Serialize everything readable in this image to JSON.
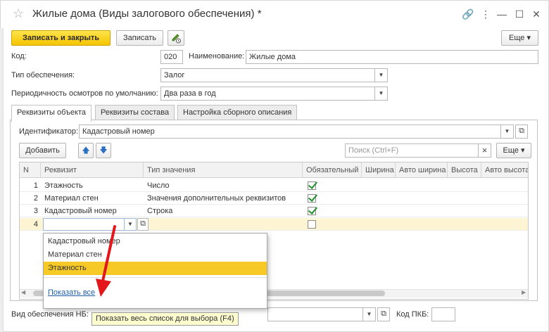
{
  "window": {
    "title": "Жилые дома (Виды залогового обеспечения) *",
    "star_glyph": "☆",
    "link_glyph": "🔗",
    "more_glyph": "⋮",
    "minimize_glyph": "—",
    "maximize_glyph": "☐",
    "close_glyph": "✕"
  },
  "toolbar": {
    "save_close_label": "Записать и закрыть",
    "save_label": "Записать",
    "edit_icon": "pencil-icon",
    "more_label": "Еще ▾"
  },
  "form": {
    "code_label": "Код:",
    "code_value": "020",
    "name_label": "Наименование:",
    "name_value": "Жилые дома",
    "security_type_label": "Тип обеспечения:",
    "security_type_value": "Залог",
    "inspection_label": "Периодичность осмотров по умолчанию:",
    "inspection_value": "Два раза в год",
    "bottom_label": "Вид обеспечения НБ:",
    "pkb_label": "Код ПКБ:"
  },
  "tabs": [
    {
      "label": "Реквизиты объекта",
      "active": true
    },
    {
      "label": "Реквизиты состава",
      "active": false
    },
    {
      "label": "Настройка сборного описания",
      "active": false
    }
  ],
  "panel": {
    "identifier_label": "Идентификатор:",
    "identifier_value": "Кадастровый номер",
    "add_label": "Добавить",
    "up_glyph": "🡅",
    "down_glyph": "🡇",
    "search_placeholder": "Поиск (Ctrl+F)",
    "clear_glyph": "×",
    "more_label": "Еще ▾"
  },
  "grid": {
    "columns": [
      "N",
      "Реквизит",
      "Тип значения",
      "Обязательный",
      "Ширина",
      "Авто ширина",
      "Высота",
      "Авто высота"
    ],
    "rows": [
      {
        "n": "1",
        "attr": "Этажность",
        "type": "Число",
        "required": true
      },
      {
        "n": "2",
        "attr": "Материал стен",
        "type": "Значения дополнительных реквизитов",
        "required": true
      },
      {
        "n": "3",
        "attr": "Кадастровый номер",
        "type": "Строка",
        "required": true
      },
      {
        "n": "4",
        "attr": "",
        "type": "",
        "required": false
      }
    ]
  },
  "dropdown": {
    "items": [
      "Кадастровый номер",
      "Материал стен",
      "Этажность"
    ],
    "selected_index": 2,
    "show_all": "Показать все"
  },
  "tooltip": "Показать весь список для выбора (F4)",
  "colors": {
    "primary_button": "#f5c400",
    "selected_row": "#fdf4d4",
    "selected_item": "#f7c926",
    "arrow": "#e3161c",
    "check": "#1e8f2a"
  }
}
